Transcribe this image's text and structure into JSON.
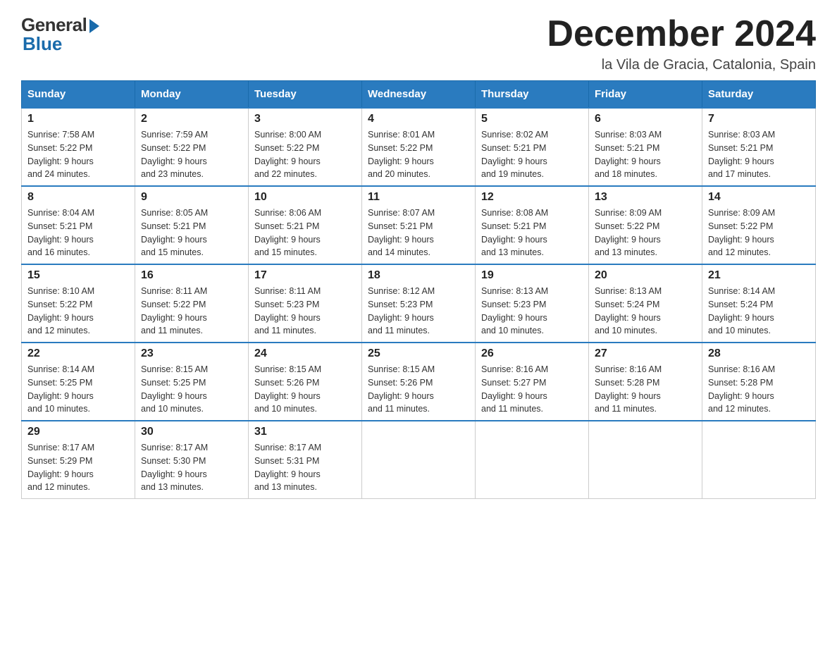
{
  "logo": {
    "general": "General",
    "blue": "Blue"
  },
  "title": "December 2024",
  "location": "la Vila de Gracia, Catalonia, Spain",
  "headers": [
    "Sunday",
    "Monday",
    "Tuesday",
    "Wednesday",
    "Thursday",
    "Friday",
    "Saturday"
  ],
  "weeks": [
    [
      {
        "day": "1",
        "sunrise": "7:58 AM",
        "sunset": "5:22 PM",
        "daylight": "9 hours and 24 minutes."
      },
      {
        "day": "2",
        "sunrise": "7:59 AM",
        "sunset": "5:22 PM",
        "daylight": "9 hours and 23 minutes."
      },
      {
        "day": "3",
        "sunrise": "8:00 AM",
        "sunset": "5:22 PM",
        "daylight": "9 hours and 22 minutes."
      },
      {
        "day": "4",
        "sunrise": "8:01 AM",
        "sunset": "5:22 PM",
        "daylight": "9 hours and 20 minutes."
      },
      {
        "day": "5",
        "sunrise": "8:02 AM",
        "sunset": "5:21 PM",
        "daylight": "9 hours and 19 minutes."
      },
      {
        "day": "6",
        "sunrise": "8:03 AM",
        "sunset": "5:21 PM",
        "daylight": "9 hours and 18 minutes."
      },
      {
        "day": "7",
        "sunrise": "8:03 AM",
        "sunset": "5:21 PM",
        "daylight": "9 hours and 17 minutes."
      }
    ],
    [
      {
        "day": "8",
        "sunrise": "8:04 AM",
        "sunset": "5:21 PM",
        "daylight": "9 hours and 16 minutes."
      },
      {
        "day": "9",
        "sunrise": "8:05 AM",
        "sunset": "5:21 PM",
        "daylight": "9 hours and 15 minutes."
      },
      {
        "day": "10",
        "sunrise": "8:06 AM",
        "sunset": "5:21 PM",
        "daylight": "9 hours and 15 minutes."
      },
      {
        "day": "11",
        "sunrise": "8:07 AM",
        "sunset": "5:21 PM",
        "daylight": "9 hours and 14 minutes."
      },
      {
        "day": "12",
        "sunrise": "8:08 AM",
        "sunset": "5:21 PM",
        "daylight": "9 hours and 13 minutes."
      },
      {
        "day": "13",
        "sunrise": "8:09 AM",
        "sunset": "5:22 PM",
        "daylight": "9 hours and 13 minutes."
      },
      {
        "day": "14",
        "sunrise": "8:09 AM",
        "sunset": "5:22 PM",
        "daylight": "9 hours and 12 minutes."
      }
    ],
    [
      {
        "day": "15",
        "sunrise": "8:10 AM",
        "sunset": "5:22 PM",
        "daylight": "9 hours and 12 minutes."
      },
      {
        "day": "16",
        "sunrise": "8:11 AM",
        "sunset": "5:22 PM",
        "daylight": "9 hours and 11 minutes."
      },
      {
        "day": "17",
        "sunrise": "8:11 AM",
        "sunset": "5:23 PM",
        "daylight": "9 hours and 11 minutes."
      },
      {
        "day": "18",
        "sunrise": "8:12 AM",
        "sunset": "5:23 PM",
        "daylight": "9 hours and 11 minutes."
      },
      {
        "day": "19",
        "sunrise": "8:13 AM",
        "sunset": "5:23 PM",
        "daylight": "9 hours and 10 minutes."
      },
      {
        "day": "20",
        "sunrise": "8:13 AM",
        "sunset": "5:24 PM",
        "daylight": "9 hours and 10 minutes."
      },
      {
        "day": "21",
        "sunrise": "8:14 AM",
        "sunset": "5:24 PM",
        "daylight": "9 hours and 10 minutes."
      }
    ],
    [
      {
        "day": "22",
        "sunrise": "8:14 AM",
        "sunset": "5:25 PM",
        "daylight": "9 hours and 10 minutes."
      },
      {
        "day": "23",
        "sunrise": "8:15 AM",
        "sunset": "5:25 PM",
        "daylight": "9 hours and 10 minutes."
      },
      {
        "day": "24",
        "sunrise": "8:15 AM",
        "sunset": "5:26 PM",
        "daylight": "9 hours and 10 minutes."
      },
      {
        "day": "25",
        "sunrise": "8:15 AM",
        "sunset": "5:26 PM",
        "daylight": "9 hours and 11 minutes."
      },
      {
        "day": "26",
        "sunrise": "8:16 AM",
        "sunset": "5:27 PM",
        "daylight": "9 hours and 11 minutes."
      },
      {
        "day": "27",
        "sunrise": "8:16 AM",
        "sunset": "5:28 PM",
        "daylight": "9 hours and 11 minutes."
      },
      {
        "day": "28",
        "sunrise": "8:16 AM",
        "sunset": "5:28 PM",
        "daylight": "9 hours and 12 minutes."
      }
    ],
    [
      {
        "day": "29",
        "sunrise": "8:17 AM",
        "sunset": "5:29 PM",
        "daylight": "9 hours and 12 minutes."
      },
      {
        "day": "30",
        "sunrise": "8:17 AM",
        "sunset": "5:30 PM",
        "daylight": "9 hours and 13 minutes."
      },
      {
        "day": "31",
        "sunrise": "8:17 AM",
        "sunset": "5:31 PM",
        "daylight": "9 hours and 13 minutes."
      },
      null,
      null,
      null,
      null
    ]
  ]
}
